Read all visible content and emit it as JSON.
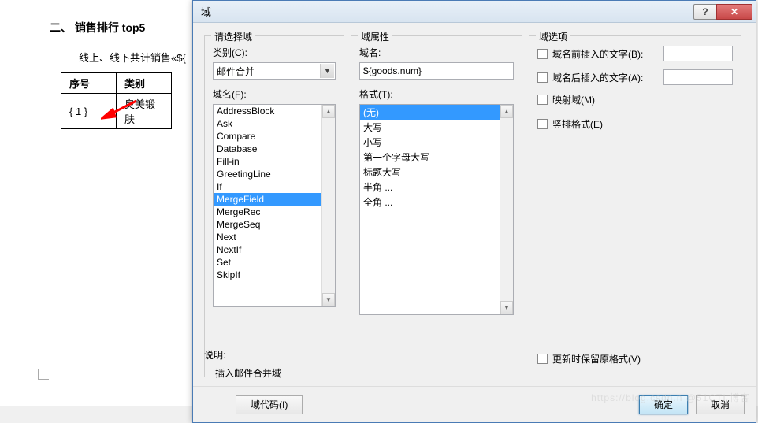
{
  "document": {
    "heading": "二、 销售排行 top5",
    "subtitle": "线上、线下共计销售«${",
    "table": {
      "headers": [
        "序号",
        "类别"
      ],
      "row": [
        "{ 1 }",
        "臭美锻肤"
      ]
    }
  },
  "dialog": {
    "title": "域",
    "groups": {
      "select": "请选择域",
      "props": "域属性",
      "options": "域选项"
    },
    "left": {
      "category_label": "类别(C):",
      "category_value": "邮件合并",
      "fieldnames_label": "域名(F):",
      "fields": [
        "AddressBlock",
        "Ask",
        "Compare",
        "Database",
        "Fill-in",
        "GreetingLine",
        "If",
        "MergeField",
        "MergeRec",
        "MergeSeq",
        "Next",
        "NextIf",
        "Set",
        "SkipIf"
      ],
      "selected_field": "MergeField"
    },
    "mid": {
      "fieldname_label": "域名:",
      "fieldname_value": "${goods.num}",
      "format_label": "格式(T):",
      "formats": [
        "(无)",
        "大写",
        "小写",
        "第一个字母大写",
        "标题大写",
        "半角 ...",
        "全角 ..."
      ],
      "selected_format": "(无)"
    },
    "right": {
      "before_label": "域名前插入的文字(B):",
      "after_label": "域名后插入的文字(A):",
      "mapped_label": "映射域(M)",
      "vertical_label": "竖排格式(E)",
      "preserve_label": "更新时保留原格式(V)"
    },
    "desc_label": "说明:",
    "desc_text": "插入邮件合并域",
    "btn_codes": "域代码(I)",
    "btn_ok": "确定",
    "btn_cancel": "取消"
  },
  "watermark": "https://blog.csdn.n @51CTI 博客"
}
